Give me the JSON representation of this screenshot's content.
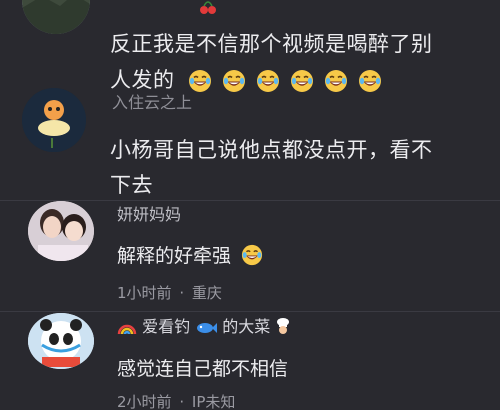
{
  "comments": [
    {
      "text_line1": "反正我是不信那个视频是喝醉了别",
      "text_line2": "人发的",
      "emoji_count": 6,
      "emoji": "laughing-crying-emoji"
    },
    {
      "username": "入住云之上",
      "text_line1": "小杨哥自己说他点都没点开，看不",
      "text_line2": "下去"
    }
  ],
  "replies": [
    {
      "username": "妍妍妈妈",
      "text": "解释的好牵强",
      "emoji": "laughing-crying-emoji",
      "time": "1小时前",
      "separator": "·",
      "location": "重庆"
    },
    {
      "username_prefix_icon": "rainbow-icon",
      "username_part1": "爱看钓",
      "username_mid_icon": "fish-icon",
      "username_part2": "的大菜",
      "username_suffix_icon": "chef-icon",
      "text": "感觉连自己都不相信",
      "time": "2小时前",
      "separator": "·",
      "location": "IP未知"
    }
  ],
  "colors": {
    "background": "#29292f",
    "text": "#ececef",
    "muted": "#9a9aa2"
  }
}
